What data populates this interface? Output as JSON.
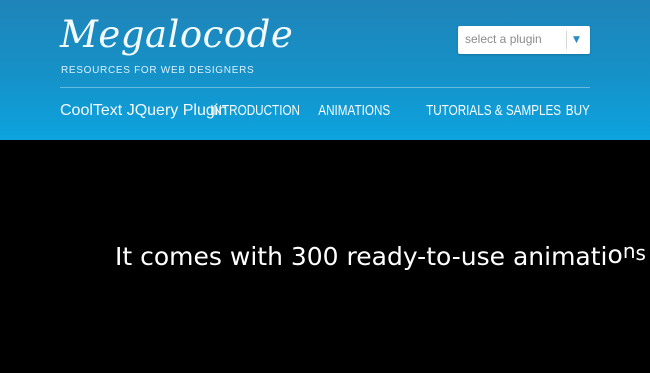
{
  "header": {
    "logo": "Megalocode",
    "tagline": "RESOURCES FOR WEB DESIGNERS",
    "plugin_select": {
      "placeholder": "select a plugin",
      "icon": "chevron-down-icon"
    },
    "product_title": "CoolText JQuery Plugin",
    "nav": [
      "INTRODUCTION",
      "ANIMATIONS",
      "TUTORIALS & SAMPLES",
      "BUY"
    ]
  },
  "hero": {
    "text_main": "It comes with 300 ready-to-use animati",
    "text_tail_1": "o",
    "text_tail_2": "n",
    "text_tail_3": "s"
  },
  "colors": {
    "header_top": "#1f84b9",
    "header_bottom": "#0da3df",
    "hero_background": "#000000",
    "text": "#ffffff",
    "select_arrow": "#2a8cc3"
  }
}
